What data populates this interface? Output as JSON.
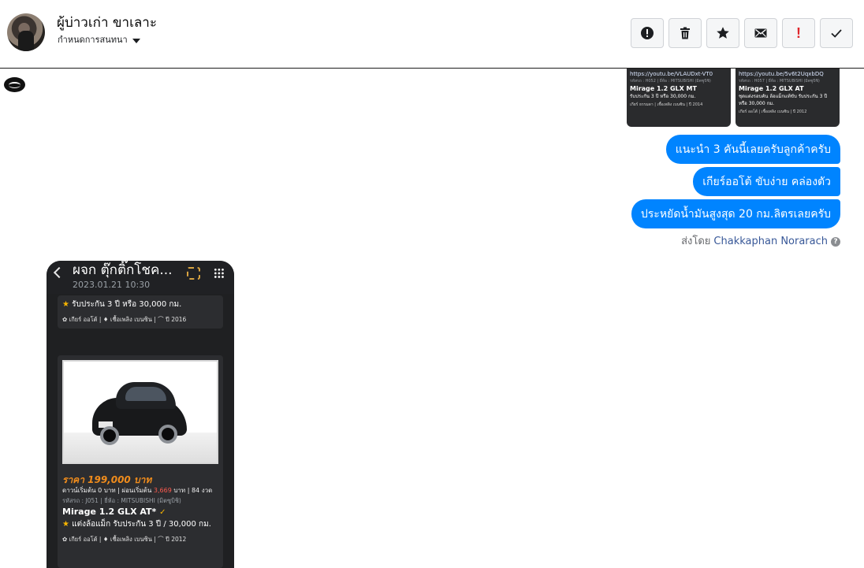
{
  "header": {
    "title": "ผู้บ่าวเก่า ขาเลาะ",
    "subtitle": "กำหนดการสนทนา"
  },
  "toolbar": {
    "buttons": [
      {
        "name": "spam-icon",
        "label": "!"
      },
      {
        "name": "trash-icon"
      },
      {
        "name": "star-icon"
      },
      {
        "name": "mail-icon"
      },
      {
        "name": "important-icon",
        "label": "!"
      },
      {
        "name": "checkmark-icon"
      }
    ],
    "important_label": "!"
  },
  "thumbs": [
    {
      "link": "https://youtu.be/VLAUDxt-VT0",
      "meta": "รหัสรถ : H052 | ยี่ห้อ : MITSUBISHI (มิตซูบิชิ)",
      "model": "Mirage 1.2 GLX MT",
      "warranty": "รับประกัน 3 ปี หรือ 30,000 กม.",
      "footer": "เกียร์ ธรรมดา | เชื้อเพลิง เบนซิน | ปี 2014"
    },
    {
      "link": "https://youtu.be/5v6t2UqxbDQ",
      "meta": "รหัสรถ : H057 | ยี่ห้อ : MITSUBISHI (มิตซูบิชิ)",
      "model": "Mirage 1.2 GLX AT",
      "warranty": "ชุดแต่งรอบคัน ล้อแม็กแท้ขับ รับประกัน 3 ปี หรือ 30,000 กม.",
      "footer": "เกียร์ ออโต้ | เชื้อเพลิง เบนซิน | ปี 2012"
    }
  ],
  "messages": [
    "แนะนำ 3 คันนี้เลยครับลูกค้าครับ",
    "เกียร์ออโต้ ขับง่าย คล่องตัว",
    "ประหยัดน้ำมันสูงสุด 20 กม.ลิตรเลยครับ"
  ],
  "sent_by": {
    "prefix": "ส่งโดย",
    "name": "Chakkaphan Norarach",
    "help": "?"
  },
  "phone": {
    "title": "ผจก ตุ๊กติ๊กโชค...",
    "date": "2023.01.21 10:30",
    "card1": {
      "warranty": "รับประกัน 3 ปี หรือ 30,000 กม.",
      "footer": "✿ เกียร์ ออโต้  |  ♦ เชื้อเพลิง เบนซิน  |  ⌒ ปี 2016"
    },
    "card2": {
      "price": "ราคา 199,000 บาท",
      "down_prefix": "ดาวน์เริ่มต้น 0 บาท | ผ่อนเริ่มต้น ",
      "down_amount": "3,669",
      "down_suffix": " บาท | 84 งวด",
      "codes": "รหัสรถ : J051 | ยี่ห้อ : MITSUBISHI (มิตซูบิชิ)",
      "model": "Mirage 1.2 GLX AT*",
      "warranty": "แต่งล้อแม็ก รับประกัน 3 ปี / 30,000 กม.",
      "footer": "✿ เกียร์ ออโต้  |  ♦ เชื้อเพลิง เบนซิน  |  ⌒ ปี 2012"
    }
  },
  "colors": {
    "bubble": "#0084ff",
    "price": "#f08c1c",
    "star": "#f7b500"
  }
}
